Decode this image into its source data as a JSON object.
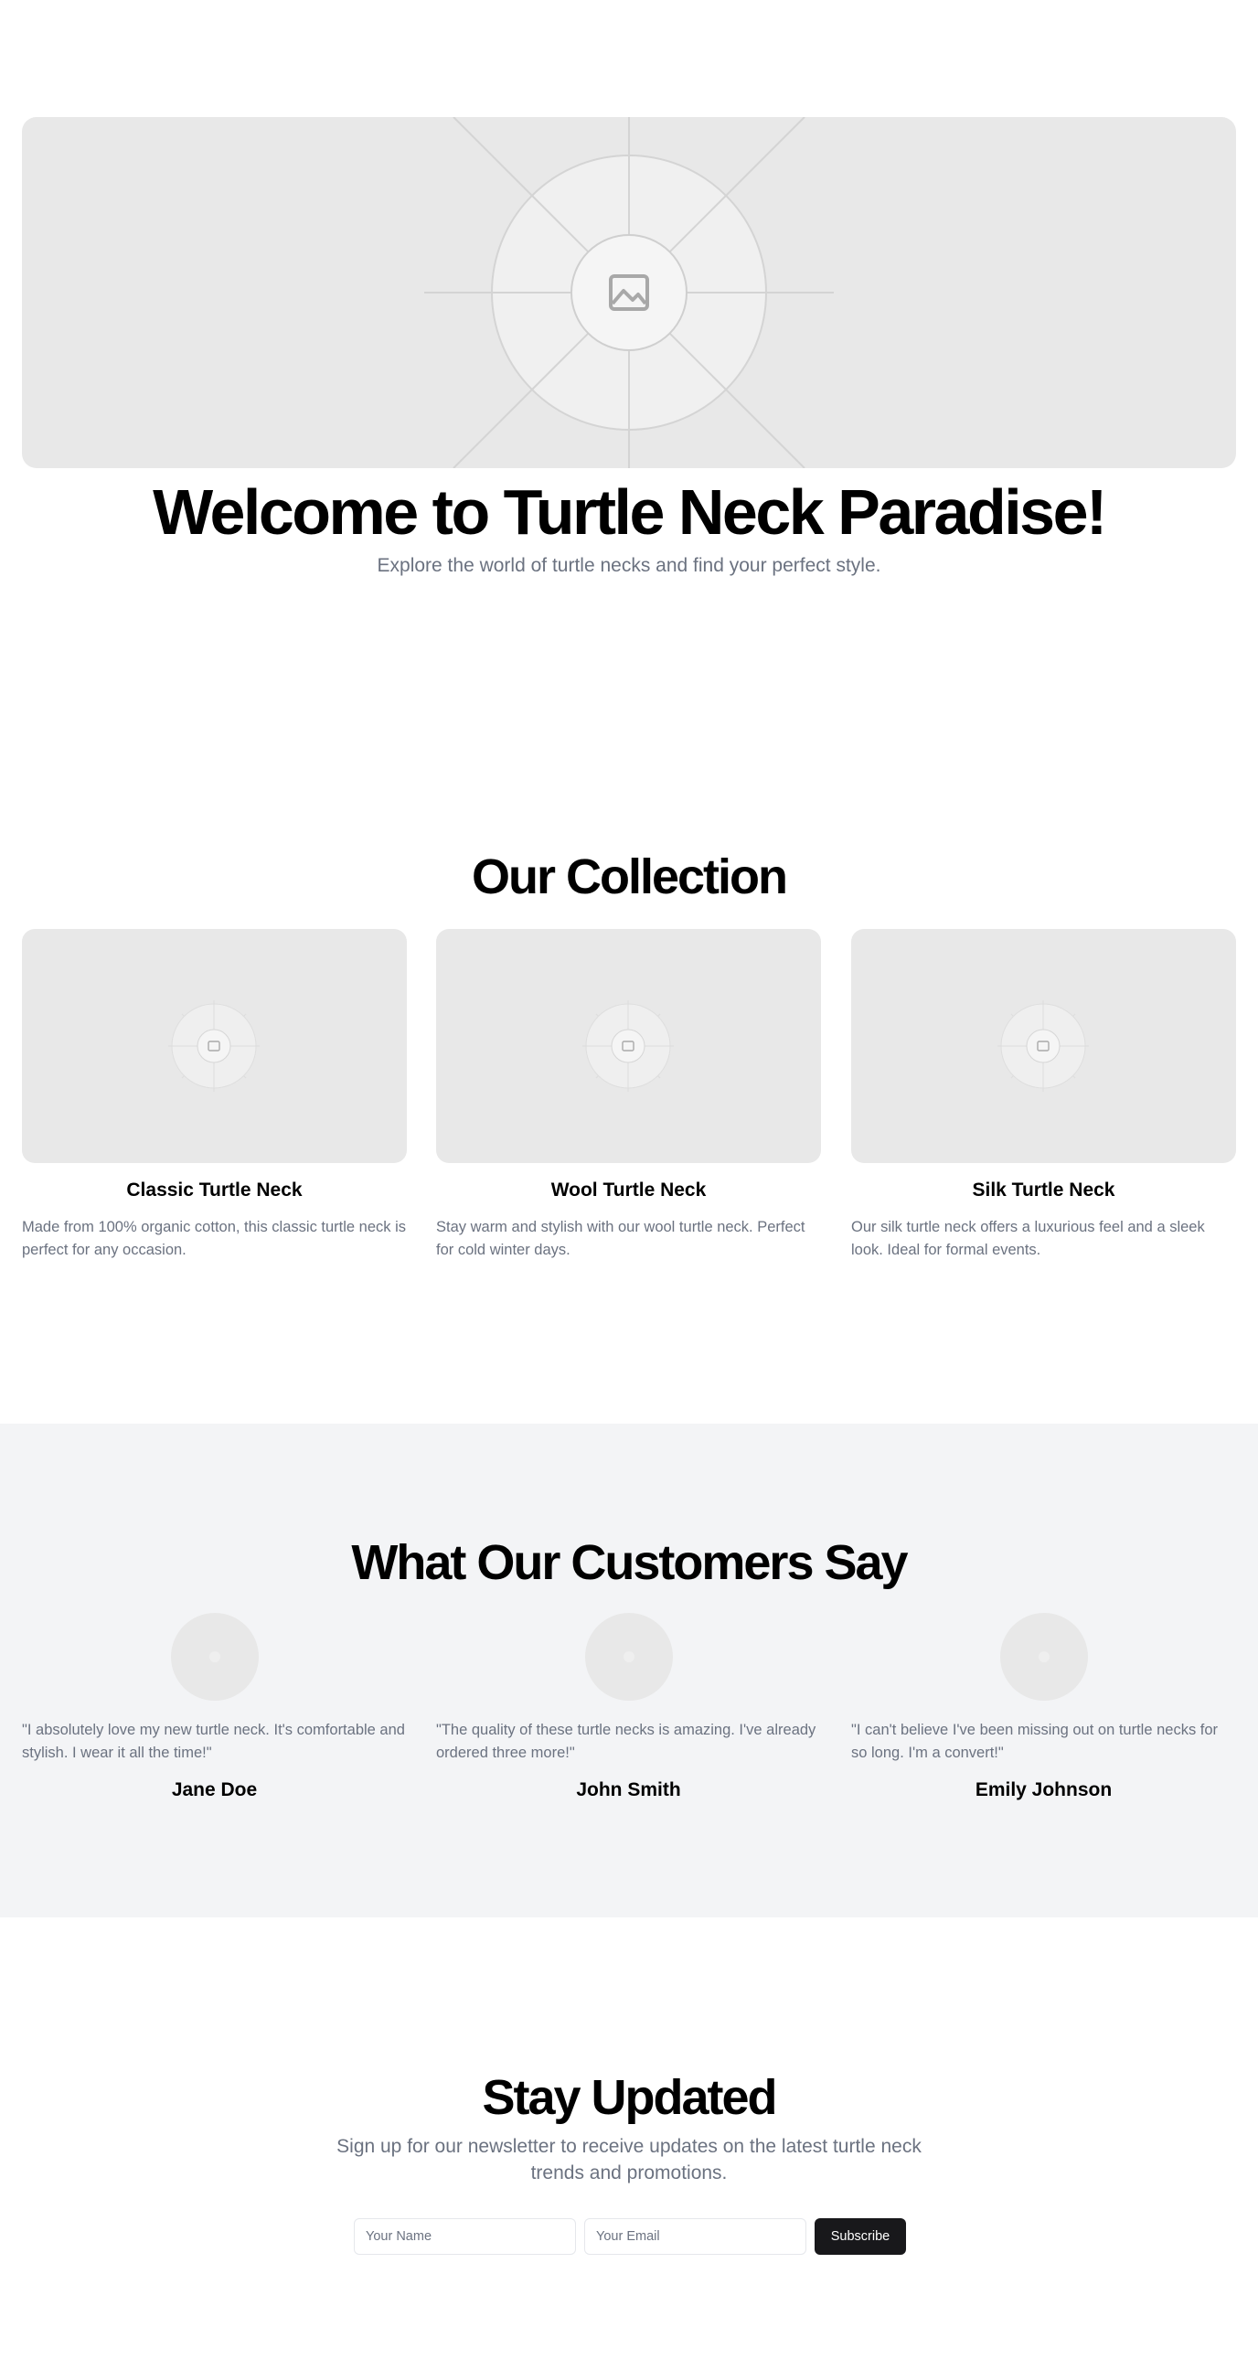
{
  "hero": {
    "image_icon": "image-placeholder-icon",
    "title": "Welcome to Turtle Neck Paradise!",
    "subtitle": "Explore the world of turtle necks and find your perfect style."
  },
  "collection": {
    "title": "Our Collection",
    "products": [
      {
        "name": "Classic Turtle Neck",
        "description": "Made from 100% organic cotton, this classic turtle neck is perfect for any occasion."
      },
      {
        "name": "Wool Turtle Neck",
        "description": "Stay warm and stylish with our wool turtle neck. Perfect for cold winter days."
      },
      {
        "name": "Silk Turtle Neck",
        "description": "Our silk turtle neck offers a luxurious feel and a sleek look. Ideal for formal events."
      }
    ]
  },
  "testimonials": {
    "title": "What Our Customers Say",
    "items": [
      {
        "quote": "\"I absolutely love my new turtle neck. It's comfortable and stylish. I wear it all the time!\"",
        "author": "Jane Doe"
      },
      {
        "quote": "\"The quality of these turtle necks is amazing. I've already ordered three more!\"",
        "author": "John Smith"
      },
      {
        "quote": "\"I can't believe I've been missing out on turtle necks for so long. I'm a convert!\"",
        "author": "Emily Johnson"
      }
    ]
  },
  "newsletter": {
    "title": "Stay Updated",
    "subtitle": "Sign up for our newsletter to receive updates on the latest turtle neck trends and promotions.",
    "name_placeholder": "Your Name",
    "email_placeholder": "Your Email",
    "subscribe_label": "Subscribe"
  },
  "colors": {
    "accent": "#18181b",
    "muted_text": "#6b7280",
    "placeholder_bg": "#e8e8e8",
    "section_bg": "#f3f4f6"
  }
}
